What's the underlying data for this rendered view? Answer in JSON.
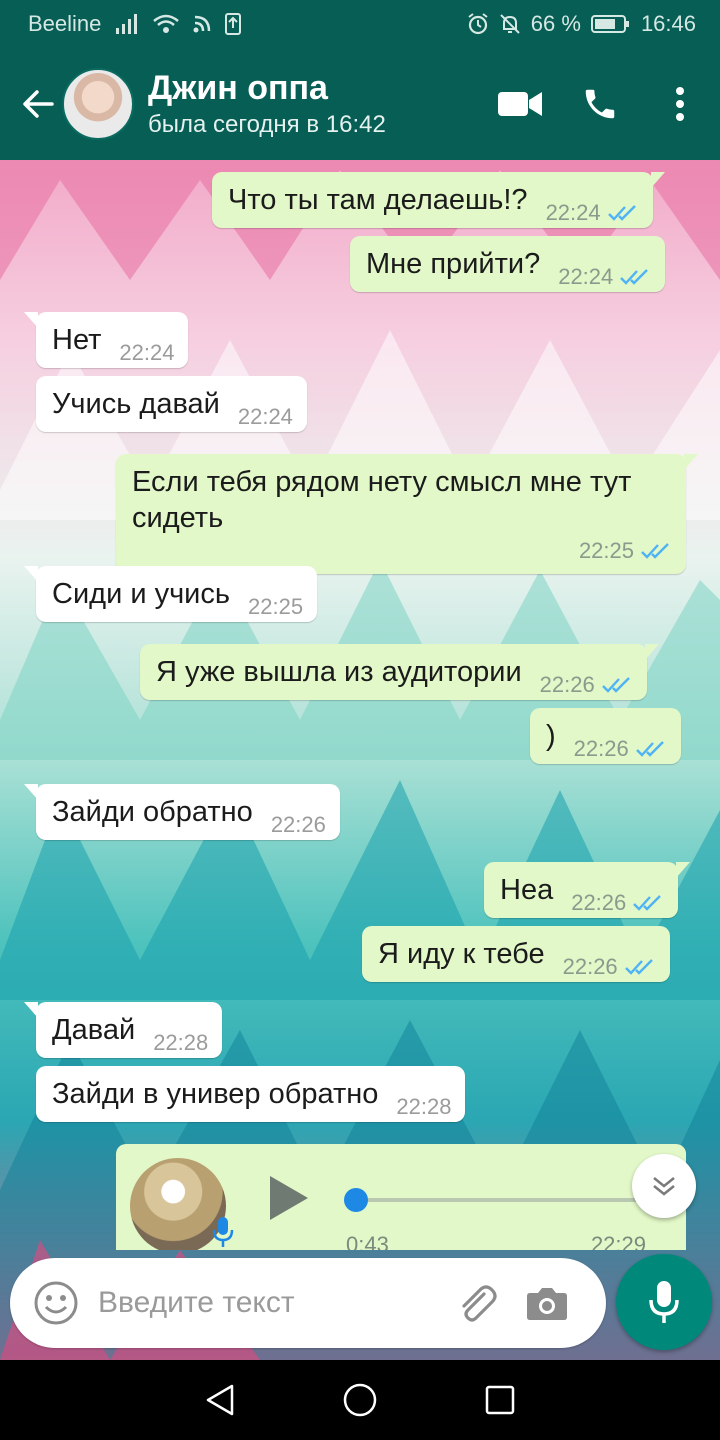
{
  "status": {
    "carrier": "Beeline",
    "battery": "66 %",
    "time": "16:46"
  },
  "header": {
    "contact_name": "Джин оппа",
    "last_seen": "была сегодня в 16:42"
  },
  "messages": [
    {
      "dir": "out",
      "text": "Что ты там делаешь!?",
      "time": "22:24"
    },
    {
      "dir": "out",
      "text": "Мне прийти?",
      "time": "22:24"
    },
    {
      "dir": "in",
      "text": "Нет",
      "time": "22:24"
    },
    {
      "dir": "in",
      "text": "Учись давай",
      "time": "22:24"
    },
    {
      "dir": "out",
      "text": "Если тебя рядом нету смысл мне тут сидеть",
      "time": "22:25"
    },
    {
      "dir": "in",
      "text": "Сиди и учись",
      "time": "22:25"
    },
    {
      "dir": "out",
      "text": "Я уже вышла из аудитории",
      "time": "22:26"
    },
    {
      "dir": "out",
      "text": ")",
      "time": "22:26"
    },
    {
      "dir": "in",
      "text": "Зайди обратно",
      "time": "22:26"
    },
    {
      "dir": "out",
      "text": "Неа",
      "time": "22:26"
    },
    {
      "dir": "out",
      "text": "Я иду к тебе",
      "time": "22:26"
    },
    {
      "dir": "in",
      "text": "Давай",
      "time": "22:28"
    },
    {
      "dir": "in",
      "text": "Зайди в универ обратно",
      "time": "22:28"
    }
  ],
  "voice_message": {
    "duration": "0:43",
    "time": "22:29",
    "progress": 0.0
  },
  "input": {
    "placeholder": "Введите текст"
  },
  "colors": {
    "header": "#075e54",
    "outgoing_bubble": "#e2f8c8",
    "incoming_bubble": "#ffffff",
    "read_ticks": "#4fb3f5",
    "mic_button": "#00897b"
  },
  "icons": {
    "status": [
      "signal-icon",
      "wifi-icon",
      "nfc-icon",
      "upload-icon",
      "alarm-icon",
      "mute-icon",
      "battery-icon"
    ],
    "header": [
      "back-arrow-icon",
      "video-call-icon",
      "phone-call-icon",
      "more-options-icon"
    ],
    "input": [
      "emoji-icon",
      "attach-icon",
      "camera-icon",
      "mic-icon"
    ],
    "nav": [
      "nav-back-icon",
      "nav-home-icon",
      "nav-recents-icon"
    ]
  }
}
